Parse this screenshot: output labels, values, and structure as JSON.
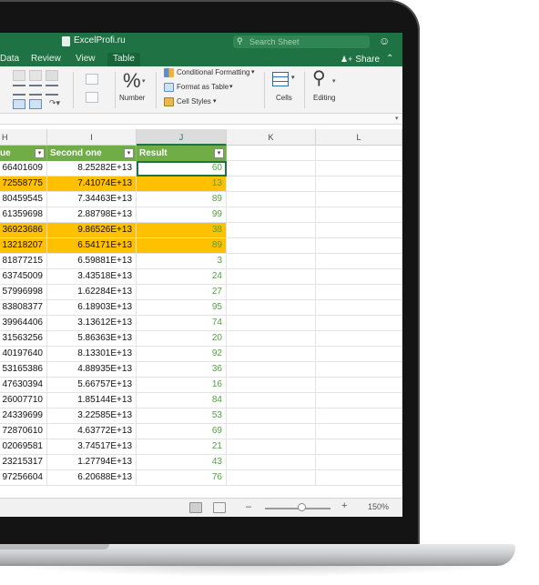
{
  "app": {
    "title": "ExcelProfi.ru"
  },
  "search": {
    "placeholder": "Search Sheet"
  },
  "tabs": [
    {
      "label": "Data",
      "active": false
    },
    {
      "label": "Review",
      "active": false
    },
    {
      "label": "View",
      "active": false
    },
    {
      "label": "Table",
      "active": true
    }
  ],
  "share": {
    "label": "Share"
  },
  "ribbon": {
    "number_label": "Number",
    "percent_glyph": "%",
    "conditional_formatting": "Conditional Formatting",
    "format_as_table": "Format as Table",
    "cell_styles": "Cell Styles",
    "cells_label": "Cells",
    "editing_label": "Editing"
  },
  "columns": [
    "H",
    "I",
    "J",
    "K",
    "L"
  ],
  "table": {
    "headers": [
      "ue",
      "Second one",
      "Result"
    ],
    "rows": [
      {
        "h": "66401609",
        "i": "8.25282E+13",
        "j": "60",
        "highlight": false,
        "active": true
      },
      {
        "h": "72558775",
        "i": "7.41074E+13",
        "j": "13",
        "highlight": true
      },
      {
        "h": "80459545",
        "i": "7.34463E+13",
        "j": "89",
        "highlight": false
      },
      {
        "h": "61359698",
        "i": "2.88798E+13",
        "j": "99",
        "highlight": false
      },
      {
        "h": "36923686",
        "i": "9.86526E+13",
        "j": "38",
        "highlight": true
      },
      {
        "h": "13218207",
        "i": "6.54171E+13",
        "j": "89",
        "highlight": true
      },
      {
        "h": "81877215",
        "i": "6.59881E+13",
        "j": "3",
        "highlight": false
      },
      {
        "h": "63745009",
        "i": "3.43518E+13",
        "j": "24",
        "highlight": false
      },
      {
        "h": "57996998",
        "i": "1.62284E+13",
        "j": "27",
        "highlight": false
      },
      {
        "h": "83808377",
        "i": "6.18903E+13",
        "j": "95",
        "highlight": false
      },
      {
        "h": "39964406",
        "i": "3.13612E+13",
        "j": "74",
        "highlight": false
      },
      {
        "h": "31563256",
        "i": "5.86363E+13",
        "j": "20",
        "highlight": false
      },
      {
        "h": "40197640",
        "i": "8.13301E+13",
        "j": "92",
        "highlight": false
      },
      {
        "h": "53165386",
        "i": "4.88935E+13",
        "j": "36",
        "highlight": false
      },
      {
        "h": "47630394",
        "i": "5.66757E+13",
        "j": "16",
        "highlight": false
      },
      {
        "h": "26007710",
        "i": "1.85144E+13",
        "j": "84",
        "highlight": false
      },
      {
        "h": "24339699",
        "i": "3.22585E+13",
        "j": "53",
        "highlight": false
      },
      {
        "h": "72870610",
        "i": "4.63772E+13",
        "j": "69",
        "highlight": false
      },
      {
        "h": "02069581",
        "i": "3.74517E+13",
        "j": "21",
        "highlight": false
      },
      {
        "h": "23215317",
        "i": "1.27794E+13",
        "j": "43",
        "highlight": false
      },
      {
        "h": "97256604",
        "i": "6.20688E+13",
        "j": "76",
        "highlight": false
      }
    ]
  },
  "status": {
    "zoom": "150%"
  },
  "colors": {
    "excel_green": "#1f7244",
    "table_header": "#70ad47",
    "highlight": "#ffc000",
    "result_text": "#4da43b"
  }
}
